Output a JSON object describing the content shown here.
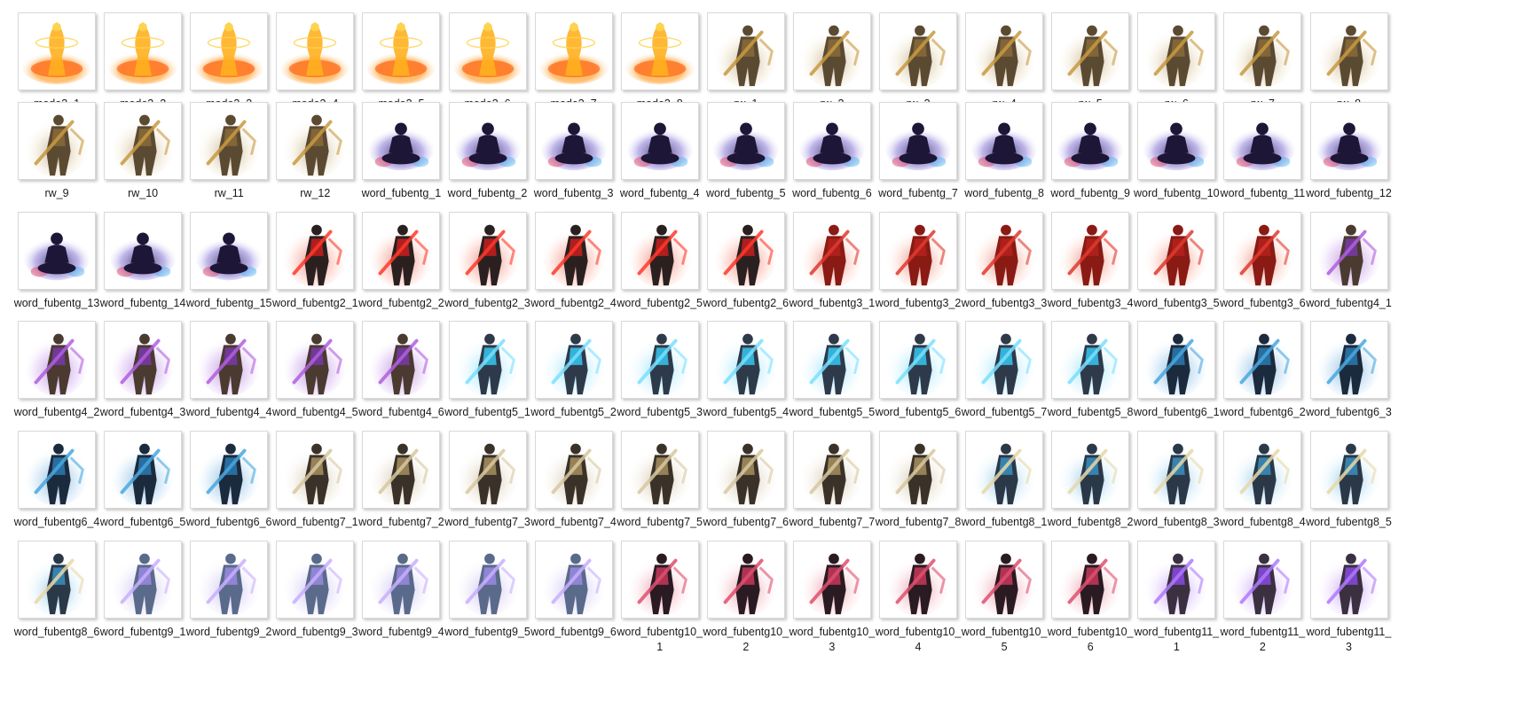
{
  "window": {
    "view": "Large icons"
  },
  "rows": [
    {
      "items": [
        {
          "name": "mode3_1",
          "kind": "fire"
        },
        {
          "name": "mode3_2",
          "kind": "fire"
        },
        {
          "name": "mode3_3",
          "kind": "fire"
        },
        {
          "name": "mode3_4",
          "kind": "fire"
        },
        {
          "name": "mode3_5",
          "kind": "fire"
        },
        {
          "name": "mode3_6",
          "kind": "fire"
        },
        {
          "name": "mode3_7",
          "kind": "fire"
        },
        {
          "name": "mode3_8",
          "kind": "fire"
        },
        {
          "name": "rw_1",
          "kind": "warrior"
        },
        {
          "name": "rw_2",
          "kind": "warrior"
        },
        {
          "name": "rw_3",
          "kind": "warrior"
        },
        {
          "name": "rw_4",
          "kind": "warrior"
        },
        {
          "name": "rw_5",
          "kind": "warrior"
        },
        {
          "name": "rw_6",
          "kind": "warrior"
        },
        {
          "name": "rw_7",
          "kind": "warrior"
        },
        {
          "name": "rw_8",
          "kind": "warrior"
        }
      ]
    },
    {
      "items": [
        {
          "name": "rw_9",
          "kind": "warrior"
        },
        {
          "name": "rw_10",
          "kind": "warrior"
        },
        {
          "name": "rw_11",
          "kind": "warrior"
        },
        {
          "name": "rw_12",
          "kind": "warrior"
        },
        {
          "name": "word_fubentg_1",
          "kind": "meditate"
        },
        {
          "name": "word_fubentg_2",
          "kind": "meditate"
        },
        {
          "name": "word_fubentg_3",
          "kind": "meditate"
        },
        {
          "name": "word_fubentg_4",
          "kind": "meditate"
        },
        {
          "name": "word_fubentg_5",
          "kind": "meditate"
        },
        {
          "name": "word_fubentg_6",
          "kind": "meditate"
        },
        {
          "name": "word_fubentg_7",
          "kind": "meditate"
        },
        {
          "name": "word_fubentg_8",
          "kind": "meditate"
        },
        {
          "name": "word_fubentg_9",
          "kind": "meditate"
        },
        {
          "name": "word_fubentg_10",
          "kind": "meditate"
        },
        {
          "name": "word_fubentg_11",
          "kind": "meditate"
        },
        {
          "name": "word_fubentg_12",
          "kind": "meditate"
        }
      ]
    },
    {
      "items": [
        {
          "name": "word_fubentg_13",
          "kind": "meditate"
        },
        {
          "name": "word_fubentg_14",
          "kind": "meditate"
        },
        {
          "name": "word_fubentg_15",
          "kind": "meditate"
        },
        {
          "name": "word_fubentg2_1",
          "kind": "redknight"
        },
        {
          "name": "word_fubentg2_2",
          "kind": "redknight"
        },
        {
          "name": "word_fubentg2_3",
          "kind": "redknight"
        },
        {
          "name": "word_fubentg2_4",
          "kind": "redknight"
        },
        {
          "name": "word_fubentg2_5",
          "kind": "redknight"
        },
        {
          "name": "word_fubentg2_6",
          "kind": "redknight"
        },
        {
          "name": "word_fubentg3_1",
          "kind": "redrobe"
        },
        {
          "name": "word_fubentg3_2",
          "kind": "redrobe"
        },
        {
          "name": "word_fubentg3_3",
          "kind": "redrobe"
        },
        {
          "name": "word_fubentg3_4",
          "kind": "redrobe"
        },
        {
          "name": "word_fubentg3_5",
          "kind": "redrobe"
        },
        {
          "name": "word_fubentg3_6",
          "kind": "redrobe"
        },
        {
          "name": "word_fubentg4_1",
          "kind": "purple"
        }
      ]
    },
    {
      "items": [
        {
          "name": "word_fubentg4_2",
          "kind": "purple"
        },
        {
          "name": "word_fubentg4_3",
          "kind": "purple"
        },
        {
          "name": "word_fubentg4_4",
          "kind": "purple"
        },
        {
          "name": "word_fubentg4_5",
          "kind": "purple"
        },
        {
          "name": "word_fubentg4_6",
          "kind": "purple"
        },
        {
          "name": "word_fubentg5_1",
          "kind": "icesword"
        },
        {
          "name": "word_fubentg5_2",
          "kind": "icesword"
        },
        {
          "name": "word_fubentg5_3",
          "kind": "icesword"
        },
        {
          "name": "word_fubentg5_4",
          "kind": "icesword"
        },
        {
          "name": "word_fubentg5_5",
          "kind": "icesword"
        },
        {
          "name": "word_fubentg5_6",
          "kind": "icesword"
        },
        {
          "name": "word_fubentg5_7",
          "kind": "icesword"
        },
        {
          "name": "word_fubentg5_8",
          "kind": "icesword"
        },
        {
          "name": "word_fubentg6_1",
          "kind": "darkblue"
        },
        {
          "name": "word_fubentg6_2",
          "kind": "darkblue"
        },
        {
          "name": "word_fubentg6_3",
          "kind": "darkblue"
        }
      ]
    },
    {
      "items": [
        {
          "name": "word_fubentg6_4",
          "kind": "darkblue"
        },
        {
          "name": "word_fubentg6_5",
          "kind": "darkblue"
        },
        {
          "name": "word_fubentg6_6",
          "kind": "darkblue"
        },
        {
          "name": "word_fubentg7_1",
          "kind": "monk"
        },
        {
          "name": "word_fubentg7_2",
          "kind": "monk"
        },
        {
          "name": "word_fubentg7_3",
          "kind": "monk"
        },
        {
          "name": "word_fubentg7_4",
          "kind": "monk"
        },
        {
          "name": "word_fubentg7_5",
          "kind": "monk"
        },
        {
          "name": "word_fubentg7_6",
          "kind": "monk"
        },
        {
          "name": "word_fubentg7_7",
          "kind": "monk"
        },
        {
          "name": "word_fubentg7_8",
          "kind": "monk"
        },
        {
          "name": "word_fubentg8_1",
          "kind": "horned"
        },
        {
          "name": "word_fubentg8_2",
          "kind": "horned"
        },
        {
          "name": "word_fubentg8_3",
          "kind": "horned"
        },
        {
          "name": "word_fubentg8_4",
          "kind": "horned"
        },
        {
          "name": "word_fubentg8_5",
          "kind": "horned"
        }
      ]
    },
    {
      "items": [
        {
          "name": "word_fubentg8_6",
          "kind": "horned"
        },
        {
          "name": "word_fubentg9_1",
          "kind": "silver"
        },
        {
          "name": "word_fubentg9_2",
          "kind": "silver"
        },
        {
          "name": "word_fubentg9_3",
          "kind": "silver"
        },
        {
          "name": "word_fubentg9_4",
          "kind": "silver"
        },
        {
          "name": "word_fubentg9_5",
          "kind": "silver"
        },
        {
          "name": "word_fubentg9_6",
          "kind": "silver"
        },
        {
          "name": "word_fubentg10_1",
          "kind": "crimson"
        },
        {
          "name": "word_fubentg10_2",
          "kind": "crimson"
        },
        {
          "name": "word_fubentg10_3",
          "kind": "crimson"
        },
        {
          "name": "word_fubentg10_4",
          "kind": "crimson"
        },
        {
          "name": "word_fubentg10_5",
          "kind": "crimson"
        },
        {
          "name": "word_fubentg10_6",
          "kind": "crimson"
        },
        {
          "name": "word_fubentg11_1",
          "kind": "violetmage"
        },
        {
          "name": "word_fubentg11_2",
          "kind": "violetmage"
        },
        {
          "name": "word_fubentg11_3",
          "kind": "violetmage"
        }
      ]
    }
  ],
  "palettes": {
    "fire": {
      "glow": "#ff8a00",
      "core": "#ffd34d",
      "body": "#ffb020",
      "accent": "#ff4a00"
    },
    "warrior": {
      "glow": "#e8d9b8",
      "core": "#8a6a3a",
      "body": "#5b4a32",
      "accent": "#c89a40"
    },
    "meditate": {
      "glow": "#8a7bd8",
      "core": "#2a1d4a",
      "body": "#1e1636",
      "accent": "#e04a6a"
    },
    "redknight": {
      "glow": "#ffb0a0",
      "core": "#c81e1e",
      "body": "#2a2020",
      "accent": "#ff3a2a"
    },
    "redrobe": {
      "glow": "#ffc0b0",
      "core": "#b4221c",
      "body": "#8a1a14",
      "accent": "#e03a30"
    },
    "purple": {
      "glow": "#d0a8f0",
      "core": "#7a3aa8",
      "body": "#4a3a30",
      "accent": "#b060e0"
    },
    "icesword": {
      "glow": "#c8f0ff",
      "core": "#36c8f0",
      "body": "#2e3a4a",
      "accent": "#7ae0ff"
    },
    "darkblue": {
      "glow": "#a8d0f0",
      "core": "#2a7ab0",
      "body": "#1c2a3e",
      "accent": "#4aa8e0"
    },
    "monk": {
      "glow": "#e8e0d0",
      "core": "#a89060",
      "body": "#3a3228",
      "accent": "#d8c8a0"
    },
    "horned": {
      "glow": "#c8e8f8",
      "core": "#3a90c0",
      "body": "#2a3848",
      "accent": "#e8d8a8"
    },
    "silver": {
      "glow": "#e0d8f8",
      "core": "#9a8ae0",
      "body": "#5a6a8a",
      "accent": "#c8b0ff"
    },
    "crimson": {
      "glow": "#f8c8d0",
      "core": "#c83a5a",
      "body": "#2a1a22",
      "accent": "#e05070"
    },
    "violetmage": {
      "glow": "#e0c8ff",
      "core": "#8a4ae0",
      "body": "#3a3040",
      "accent": "#b07aff"
    }
  }
}
